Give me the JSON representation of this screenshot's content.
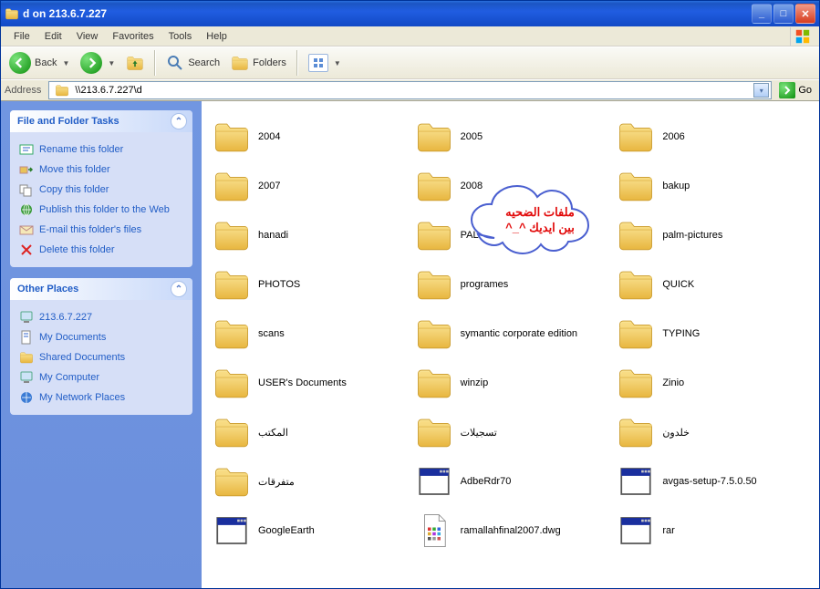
{
  "titlebar": {
    "title": "d on 213.6.7.227"
  },
  "menu": {
    "file": "File",
    "edit": "Edit",
    "view": "View",
    "favorites": "Favorites",
    "tools": "Tools",
    "help": "Help"
  },
  "toolbar": {
    "back": "Back",
    "search": "Search",
    "folders": "Folders"
  },
  "addressbar": {
    "label": "Address",
    "value": "\\\\213.6.7.227\\d",
    "go": "Go"
  },
  "sidebar": {
    "tasks": {
      "title": "File and Folder Tasks",
      "items": [
        {
          "icon": "rename",
          "label": "Rename this folder"
        },
        {
          "icon": "move",
          "label": "Move this folder"
        },
        {
          "icon": "copy",
          "label": "Copy this folder"
        },
        {
          "icon": "publish",
          "label": "Publish this folder to the Web"
        },
        {
          "icon": "email",
          "label": "E-mail this folder's files"
        },
        {
          "icon": "delete",
          "label": "Delete this folder"
        }
      ]
    },
    "places": {
      "title": "Other Places",
      "items": [
        {
          "icon": "computer",
          "label": "213.6.7.227"
        },
        {
          "icon": "mydocs",
          "label": "My Documents"
        },
        {
          "icon": "shared",
          "label": "Shared Documents"
        },
        {
          "icon": "mycomputer",
          "label": "My Computer"
        },
        {
          "icon": "network",
          "label": "My Network Places"
        }
      ]
    }
  },
  "content": {
    "items": [
      {
        "type": "folder",
        "label": "2004"
      },
      {
        "type": "folder",
        "label": "2005"
      },
      {
        "type": "folder",
        "label": "2006"
      },
      {
        "type": "folder",
        "label": "2007"
      },
      {
        "type": "folder",
        "label": "2008"
      },
      {
        "type": "folder",
        "label": "bakup"
      },
      {
        "type": "folder",
        "label": "hanadi"
      },
      {
        "type": "folder",
        "label": "PALM"
      },
      {
        "type": "folder",
        "label": "palm-pictures"
      },
      {
        "type": "folder",
        "label": "PHOTOS"
      },
      {
        "type": "folder",
        "label": "programes"
      },
      {
        "type": "folder",
        "label": "QUICK"
      },
      {
        "type": "folder",
        "label": "scans"
      },
      {
        "type": "folder",
        "label": "symantic corporate edition"
      },
      {
        "type": "folder",
        "label": "TYPING"
      },
      {
        "type": "folder",
        "label": "USER's Documents"
      },
      {
        "type": "folder",
        "label": "winzip"
      },
      {
        "type": "folder",
        "label": "Zinio"
      },
      {
        "type": "folder",
        "label": "المكتب"
      },
      {
        "type": "folder",
        "label": "تسجيلات"
      },
      {
        "type": "folder",
        "label": "خلدون"
      },
      {
        "type": "folder",
        "label": "متفرقات"
      },
      {
        "type": "app",
        "label": "AdbeRdr70"
      },
      {
        "type": "app",
        "label": "avgas-setup-7.5.0.50"
      },
      {
        "type": "app",
        "label": "GoogleEarth"
      },
      {
        "type": "doc",
        "label": "ramallahfinal2007.dwg"
      },
      {
        "type": "app",
        "label": "rar"
      }
    ]
  },
  "cloud": {
    "line1": "ملفات الضحيه",
    "line2": "بين ايديك ^_^"
  }
}
